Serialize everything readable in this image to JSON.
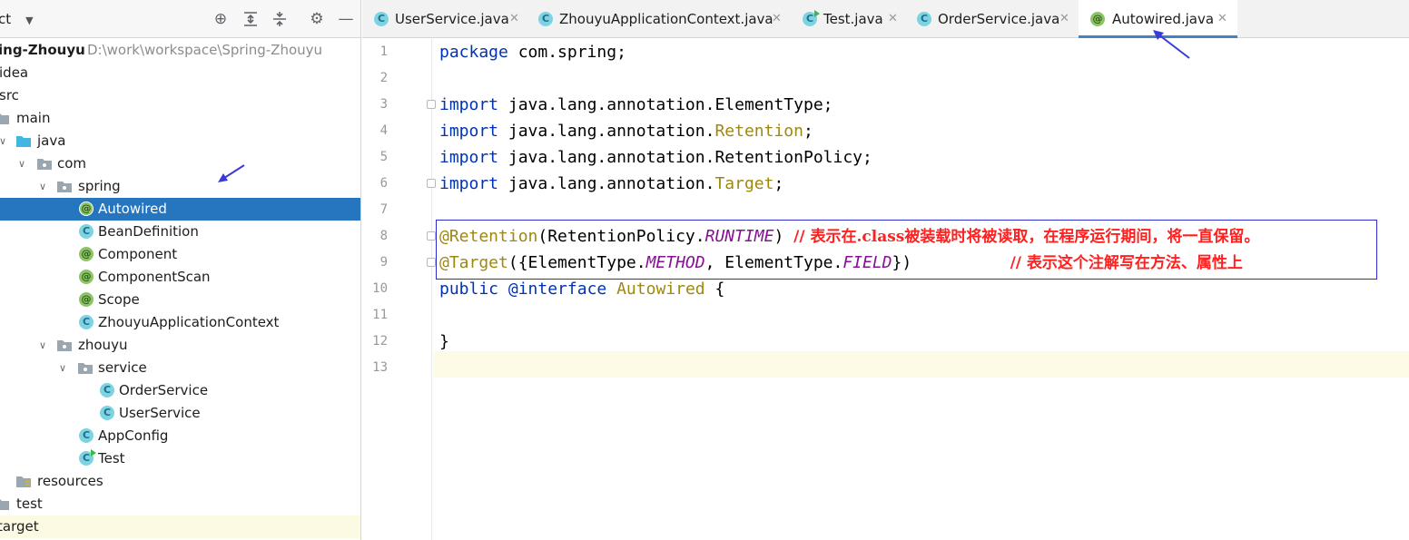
{
  "panel": {
    "title": "ct",
    "icons": [
      "locate-icon",
      "expand-all-icon",
      "collapse-all-icon",
      "gear-icon",
      "minimize-icon"
    ]
  },
  "tree": [
    {
      "label": "ing-Zhouyu",
      "path": "D:\\work\\workspace\\Spring-Zhouyu",
      "icon": "none"
    },
    {
      "label": "idea",
      "icon": "none"
    },
    {
      "label": "src",
      "icon": "none"
    },
    {
      "label": "main",
      "icon": "folder"
    },
    {
      "label": "java",
      "icon": "source-folder"
    },
    {
      "label": "com",
      "icon": "package"
    },
    {
      "label": "spring",
      "icon": "package"
    },
    {
      "label": "Autowired",
      "icon": "annotation"
    },
    {
      "label": "BeanDefinition",
      "icon": "class"
    },
    {
      "label": "Component",
      "icon": "annotation"
    },
    {
      "label": "ComponentScan",
      "icon": "annotation"
    },
    {
      "label": "Scope",
      "icon": "annotation"
    },
    {
      "label": "ZhouyuApplicationContext",
      "icon": "class"
    },
    {
      "label": "zhouyu",
      "icon": "package"
    },
    {
      "label": "service",
      "icon": "package"
    },
    {
      "label": "OrderService",
      "icon": "class"
    },
    {
      "label": "UserService",
      "icon": "class"
    },
    {
      "label": "AppConfig",
      "icon": "class"
    },
    {
      "label": "Test",
      "icon": "runnable-class"
    },
    {
      "label": "resources",
      "icon": "resources-folder"
    },
    {
      "label": "test",
      "icon": "folder"
    },
    {
      "label": "target",
      "icon": "none"
    }
  ],
  "tabs": [
    {
      "label": "UserService.java",
      "icon": "C"
    },
    {
      "label": "ZhouyuApplicationContext.java",
      "icon": "C"
    },
    {
      "label": "Test.java",
      "icon": "C"
    },
    {
      "label": "OrderService.java",
      "icon": "C"
    },
    {
      "label": "Autowired.java",
      "icon": "@",
      "active": true
    }
  ],
  "editor": {
    "line_numbers": [
      "1",
      "2",
      "3",
      "4",
      "5",
      "6",
      "7",
      "8",
      "9",
      "10",
      "11",
      "12",
      "13"
    ],
    "code": {
      "l1_kw": "package",
      "l1_rest": " com.spring;",
      "l3_kw": "import",
      "l3_rest": " java.lang.annotation.ElementType;",
      "l4_kw": "import",
      "l4_pre": " java.lang.annotation.",
      "l4_ann": "Retention",
      "l4_post": ";",
      "l5_kw": "import",
      "l5_rest": " java.lang.annotation.RetentionPolicy;",
      "l6_kw": "import",
      "l6_pre": " java.lang.annotation.",
      "l6_ann": "Target",
      "l6_post": ";",
      "l8_ann": "@Retention",
      "l8_pre": "(RetentionPolicy.",
      "l8_cst": "RUNTIME",
      "l8_post": ") ",
      "l8_comment": "// 表示在.class被装载时将被读取，在程序运行期间，将一直保留。",
      "l9_ann": "@Target",
      "l9_pre": "({ElementType.",
      "l9_cst1": "METHOD",
      "l9_mid": ", ElementType.",
      "l9_cst2": "FIELD",
      "l9_post": "})          ",
      "l9_comment": "// 表示这个注解写在方法、属性上",
      "l10_kw": "public",
      "l10_mid": " ",
      "l10_kw2": "@interface",
      "l10_sp": " ",
      "l10_name": "Autowired",
      "l10_post": " {",
      "l12": "}"
    }
  },
  "colors": {
    "selection": "#2675bf",
    "keyword": "#0033b3",
    "annotation": "#9e880d",
    "constant": "#871094",
    "comment": "#ff2020",
    "highlight_box": "#2b2bd0",
    "arrow": "#3a3ad8"
  }
}
